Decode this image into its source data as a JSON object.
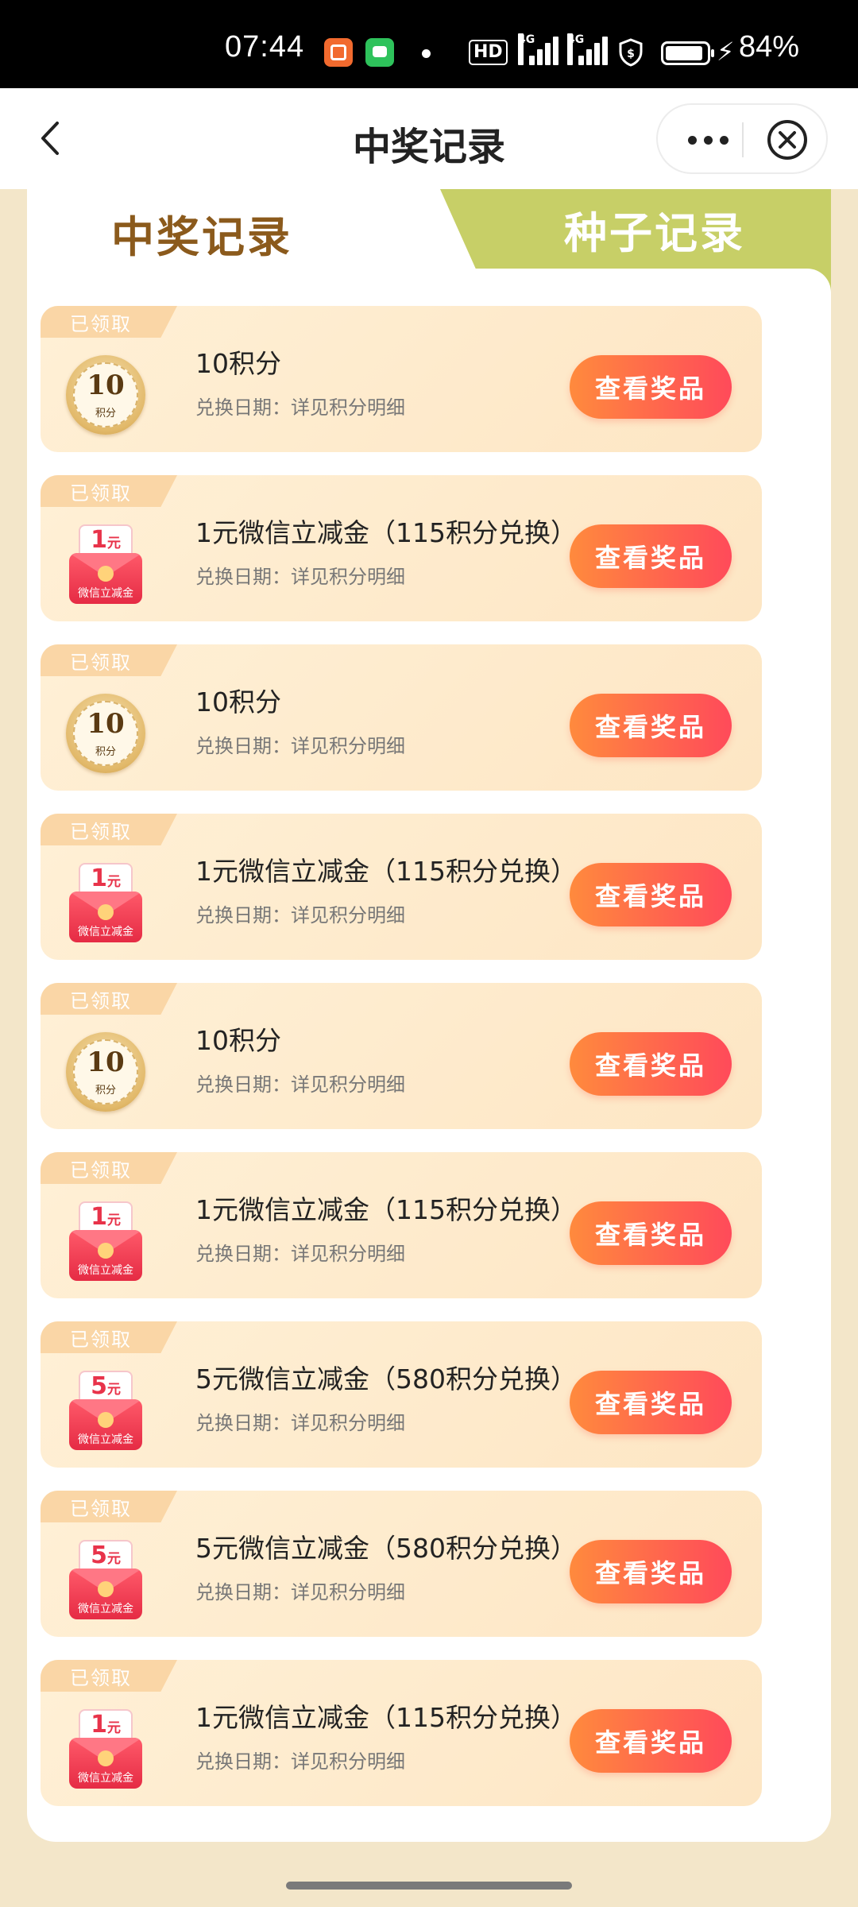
{
  "status_bar": {
    "time": "07:44",
    "hd_label": "HD",
    "signal_label_1": "4G",
    "signal_label_2": "4G",
    "battery": "84%"
  },
  "nav": {
    "title": "中奖记录",
    "back_icon": "chevron-left-icon",
    "more_icon": "more-dots-icon",
    "close_icon": "close-circle-icon"
  },
  "tabs": {
    "active": "中奖记录",
    "inactive": "种子记录"
  },
  "colors": {
    "tab_active_text": "#8b5a1c",
    "tab_inactive_bg": "#c7cf67",
    "button_gradient_start": "#ff8a3d",
    "button_gradient_end": "#ff4a5a",
    "badge_bg": "#fad6a6",
    "page_bg": "#f3e6c9"
  },
  "records": [
    {
      "status": "已领取",
      "name": "10积分",
      "date": "兑换日期：详见积分明细",
      "button": "查看奖品",
      "icon": "points-coin",
      "coin_value": "10",
      "coin_label": "积分"
    },
    {
      "status": "已领取",
      "name": "1元微信立减金（115积分兑换）",
      "date": "兑换日期：详见积分明细",
      "button": "查看奖品",
      "icon": "red-envelope",
      "amount": "1",
      "unit": "元",
      "env_label": "微信立减金"
    },
    {
      "status": "已领取",
      "name": "10积分",
      "date": "兑换日期：详见积分明细",
      "button": "查看奖品",
      "icon": "points-coin",
      "coin_value": "10",
      "coin_label": "积分"
    },
    {
      "status": "已领取",
      "name": "1元微信立减金（115积分兑换）",
      "date": "兑换日期：详见积分明细",
      "button": "查看奖品",
      "icon": "red-envelope",
      "amount": "1",
      "unit": "元",
      "env_label": "微信立减金"
    },
    {
      "status": "已领取",
      "name": "10积分",
      "date": "兑换日期：详见积分明细",
      "button": "查看奖品",
      "icon": "points-coin",
      "coin_value": "10",
      "coin_label": "积分"
    },
    {
      "status": "已领取",
      "name": "1元微信立减金（115积分兑换）",
      "date": "兑换日期：详见积分明细",
      "button": "查看奖品",
      "icon": "red-envelope",
      "amount": "1",
      "unit": "元",
      "env_label": "微信立减金"
    },
    {
      "status": "已领取",
      "name": "5元微信立减金（580积分兑换）",
      "date": "兑换日期：详见积分明细",
      "button": "查看奖品",
      "icon": "red-envelope",
      "amount": "5",
      "unit": "元",
      "env_label": "微信立减金"
    },
    {
      "status": "已领取",
      "name": "5元微信立减金（580积分兑换）",
      "date": "兑换日期：详见积分明细",
      "button": "查看奖品",
      "icon": "red-envelope",
      "amount": "5",
      "unit": "元",
      "env_label": "微信立减金"
    },
    {
      "status": "已领取",
      "name": "1元微信立减金（115积分兑换）",
      "date": "兑换日期：详见积分明细",
      "button": "查看奖品",
      "icon": "red-envelope",
      "amount": "1",
      "unit": "元",
      "env_label": "微信立减金"
    }
  ]
}
